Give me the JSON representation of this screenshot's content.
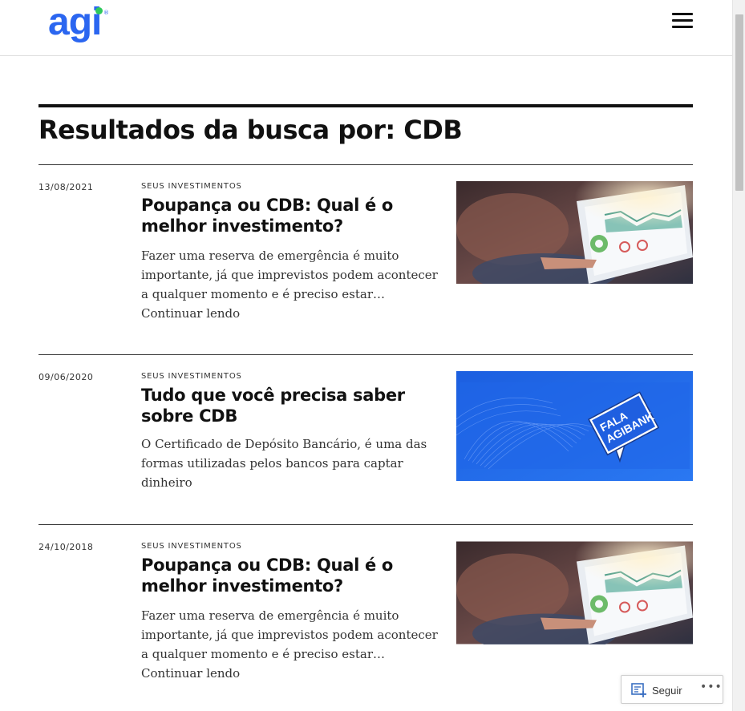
{
  "header": {
    "logo_text": "agi",
    "logo_reg": "®",
    "menu_icon": "hamburger-menu-icon",
    "brand_color": "#2b66f0",
    "logo_dot_color": "#2ec95c"
  },
  "search": {
    "title": "Resultados da busca por: CDB"
  },
  "posts": [
    {
      "date": "13/08/2021",
      "category": "SEUS INVESTIMENTOS",
      "title": "Poupança ou CDB: Qual é o melhor investimento?",
      "excerpt": "Fazer uma reserva de emergência é muito importante, já que imprevistos podem acontecer a qualquer momento e é preciso estar…",
      "more": "Continuar lendo"
    },
    {
      "date": "09/06/2020",
      "category": "SEUS INVESTIMENTOS",
      "title": "Tudo que você precisa saber sobre CDB",
      "excerpt": "O Certificado de Depósito Bancário, é uma das formas utilizadas pelos bancos para captar dinheiro",
      "thumb_text": "FALA AGIBANK"
    },
    {
      "date": "24/10/2018",
      "category": "SEUS INVESTIMENTOS",
      "title": "Poupança ou CDB: Qual é o melhor investimento?",
      "excerpt": "Fazer uma reserva de emergência é muito importante, já que imprevistos podem acontecer a qualquer momento e é preciso estar…",
      "more": "Continuar lendo"
    }
  ],
  "follow": {
    "label": "Seguir",
    "more": "•••",
    "icon": "reader-follow-icon"
  }
}
